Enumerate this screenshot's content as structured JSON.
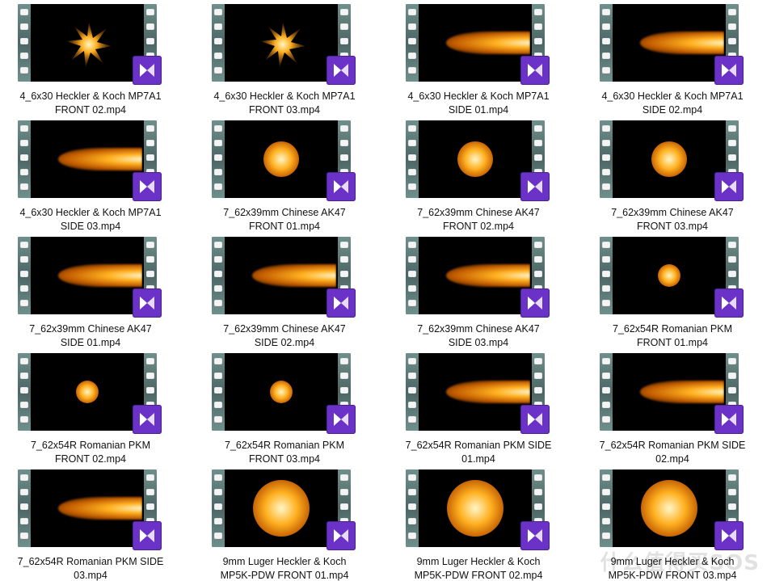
{
  "files": [
    {
      "line1": "4_6x30 Heckler & Koch MP7A1",
      "line2": "FRONT 02.mp4",
      "kind": "star"
    },
    {
      "line1": "4_6x30 Heckler & Koch MP7A1",
      "line2": "FRONT 03.mp4",
      "kind": "star"
    },
    {
      "line1": "4_6x30 Heckler & Koch MP7A1",
      "line2": "SIDE 01.mp4",
      "kind": "side"
    },
    {
      "line1": "4_6x30 Heckler & Koch MP7A1",
      "line2": "SIDE 02.mp4",
      "kind": "side"
    },
    {
      "line1": "4_6x30 Heckler & Koch MP7A1",
      "line2": "SIDE 03.mp4",
      "kind": "side"
    },
    {
      "line1": "7_62x39mm Chinese AK47",
      "line2": "FRONT 01.mp4",
      "kind": "blob"
    },
    {
      "line1": "7_62x39mm Chinese AK47",
      "line2": "FRONT 02.mp4",
      "kind": "blob"
    },
    {
      "line1": "7_62x39mm Chinese AK47",
      "line2": "FRONT 03.mp4",
      "kind": "blob"
    },
    {
      "line1": "7_62x39mm Chinese AK47",
      "line2": "SIDE 01.mp4",
      "kind": "side"
    },
    {
      "line1": "7_62x39mm Chinese AK47",
      "line2": "SIDE 02.mp4",
      "kind": "side"
    },
    {
      "line1": "7_62x39mm Chinese AK47",
      "line2": "SIDE 03.mp4",
      "kind": "side"
    },
    {
      "line1": "7_62x54R Romanian PKM",
      "line2": "FRONT 01.mp4",
      "kind": "small"
    },
    {
      "line1": "7_62x54R Romanian PKM",
      "line2": "FRONT 02.mp4",
      "kind": "small"
    },
    {
      "line1": "7_62x54R Romanian PKM",
      "line2": "FRONT 03.mp4",
      "kind": "small"
    },
    {
      "line1": "7_62x54R Romanian PKM SIDE",
      "line2": "01.mp4",
      "kind": "side"
    },
    {
      "line1": "7_62x54R Romanian PKM SIDE",
      "line2": "02.mp4",
      "kind": "side"
    },
    {
      "line1": "7_62x54R Romanian PKM SIDE",
      "line2": "03.mp4",
      "kind": "side"
    },
    {
      "line1": "9mm Luger Heckler & Koch",
      "line2": "MP5K-PDW FRONT 01.mp4",
      "kind": "big"
    },
    {
      "line1": "9mm Luger Heckler & Koch",
      "line2": "MP5K-PDW FRONT 02.mp4",
      "kind": "big"
    },
    {
      "line1": "9mm Luger Heckler & Koch",
      "line2": "MP5K-PDW FRONT 03.mp4",
      "kind": "big"
    }
  ],
  "icons": {
    "thumbnail": "video-thumbnail-icon",
    "badge": "video-player-badge-icon"
  },
  "colors": {
    "badge": "#6b32c8",
    "film_rail": "#5a7a78",
    "flash_core": "#fff6c8",
    "flash_mid": "#ffb020",
    "flash_edge": "#c05a00"
  },
  "watermark": "什么值得买SOS"
}
